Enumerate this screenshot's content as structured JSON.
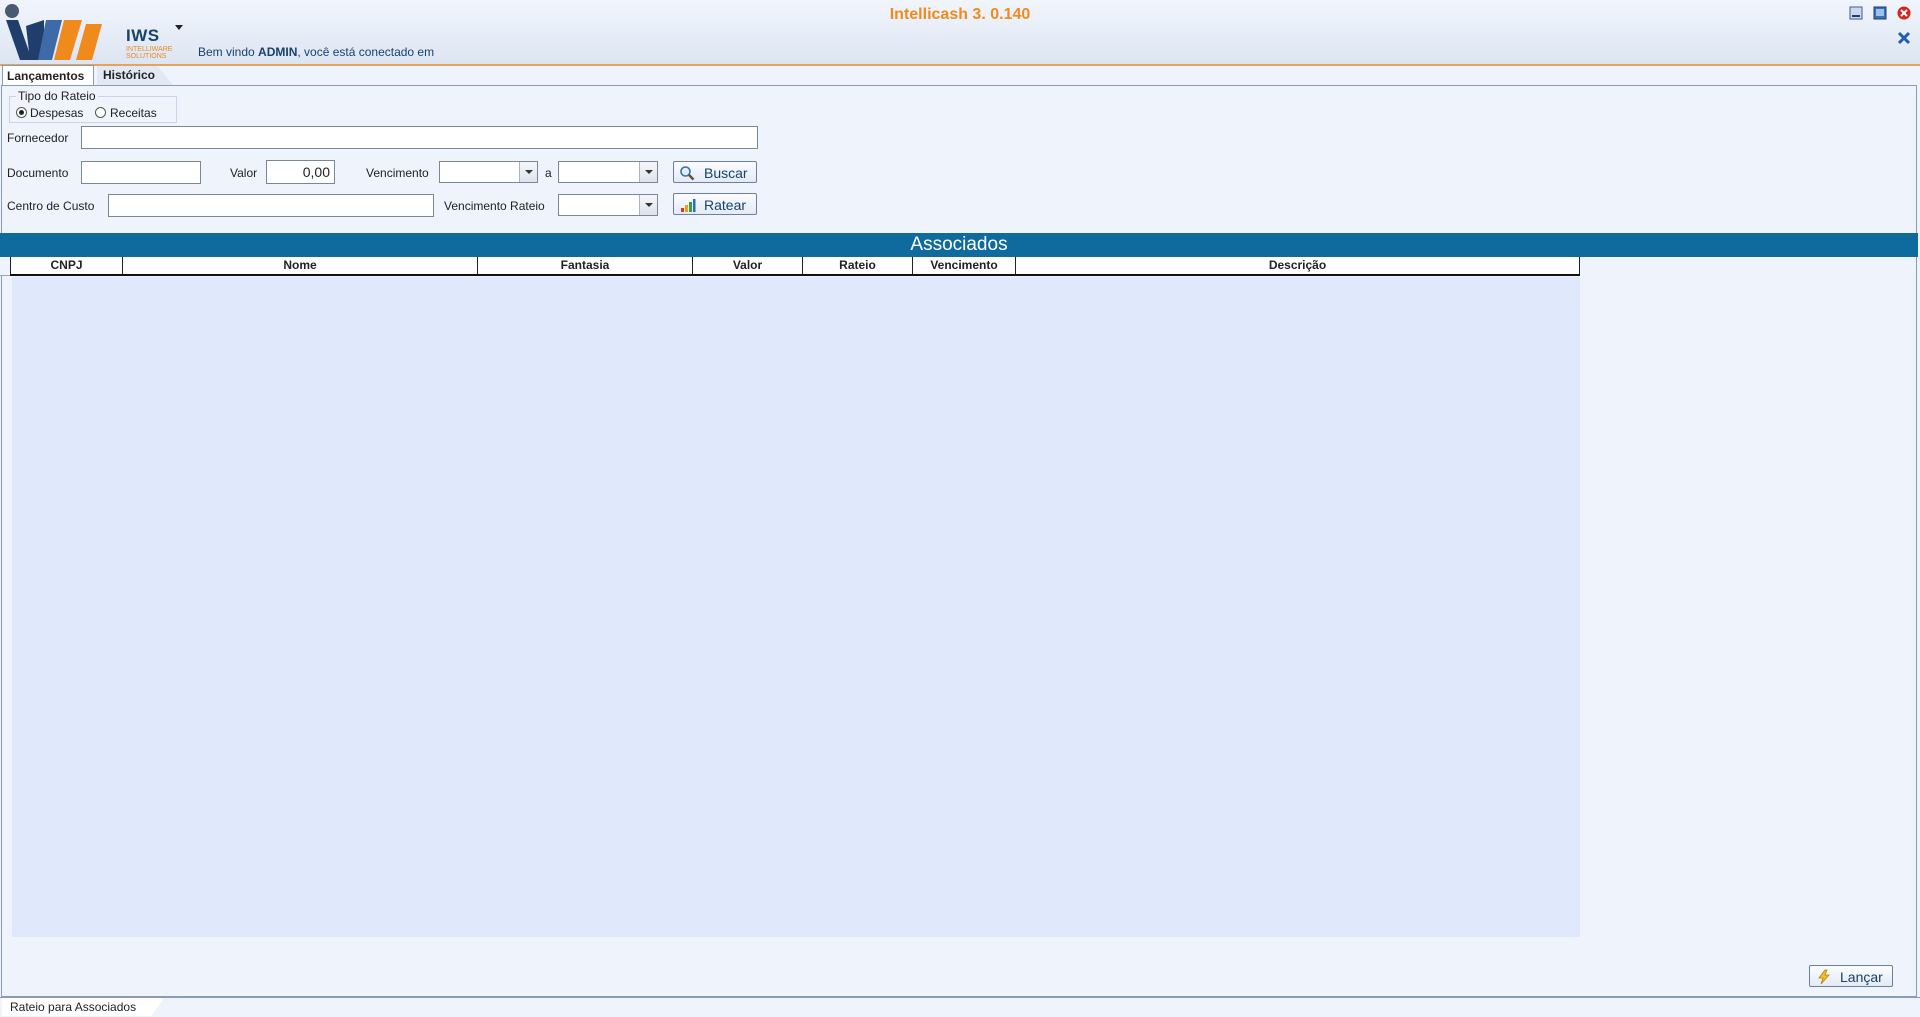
{
  "window": {
    "title": "Intellicash 3. 0.140",
    "brand": "IWS",
    "brand_subtitle_1": "INTELLIWARE",
    "brand_subtitle_2": "SOLUTIONS",
    "welcome_prefix": "Bem vindo ",
    "welcome_user": "ADMIN",
    "welcome_suffix": ", você está conectado em"
  },
  "tabs": [
    {
      "label": "Lançamentos",
      "active": true
    },
    {
      "label": "Histórico",
      "active": false
    }
  ],
  "form": {
    "tipo_rateio": {
      "legend": "Tipo do Rateio",
      "options": [
        {
          "label": "Despesas",
          "selected": true
        },
        {
          "label": "Receitas",
          "selected": false
        }
      ]
    },
    "fornecedor": {
      "label": "Fornecedor",
      "value": ""
    },
    "documento": {
      "label": "Documento",
      "value": ""
    },
    "valor": {
      "label": "Valor",
      "value": "0,00"
    },
    "vencimento": {
      "label": "Vencimento",
      "from": "",
      "separator": "a",
      "to": ""
    },
    "centro_custo": {
      "label": "Centro de Custo",
      "value": ""
    },
    "vencimento_rateio": {
      "label": "Vencimento Rateio",
      "value": ""
    },
    "buscar_label": "Buscar",
    "ratear_label": "Ratear"
  },
  "grid": {
    "caption": "Associados",
    "columns": [
      "CNPJ",
      "Nome",
      "Fantasia",
      "Valor",
      "Rateio",
      "Vencimento",
      "Descrição"
    ],
    "rows": []
  },
  "footer": {
    "lancar_label": "Lançar",
    "status_tab": "Rateio para Associados"
  },
  "colors": {
    "title": "#f08a1c",
    "brand": "#16426e",
    "grid_caption_bg": "#0f6a9e",
    "grid_body_bg": "#e0e8fb"
  }
}
